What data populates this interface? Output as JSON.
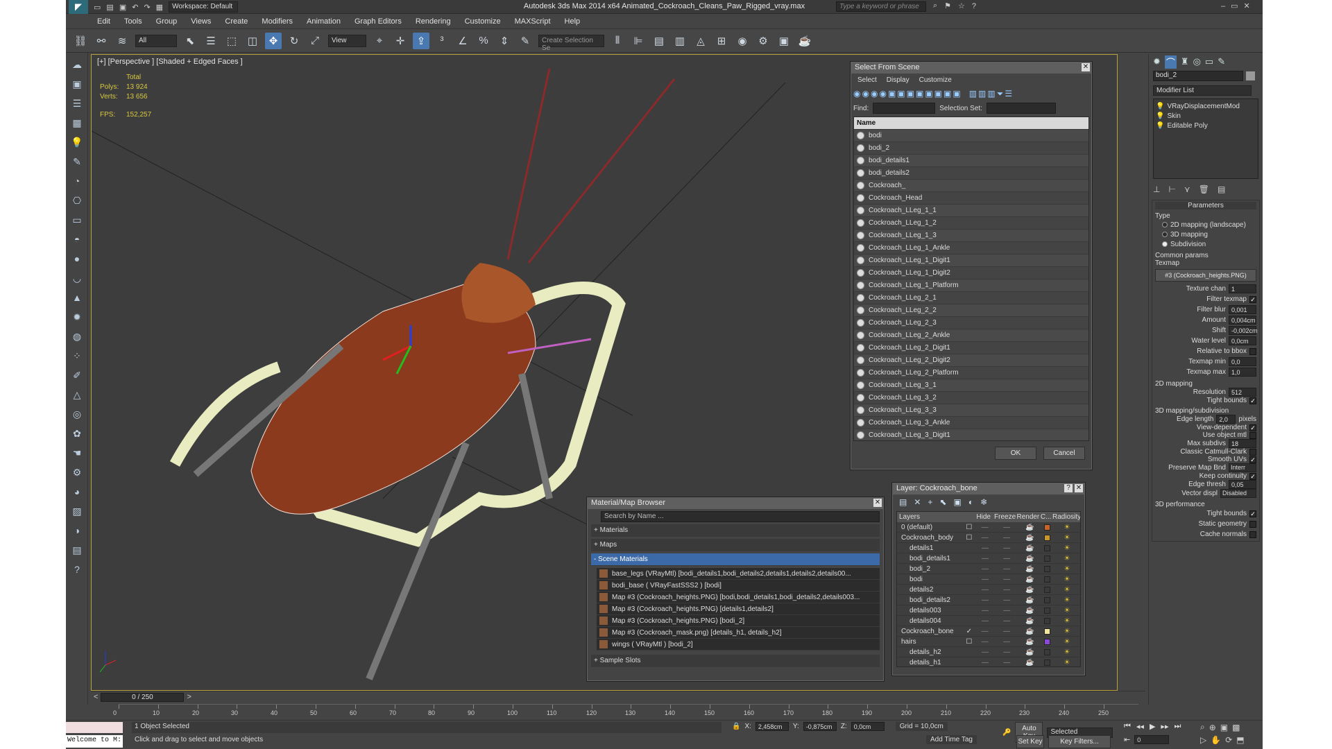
{
  "app": {
    "title": "Autodesk 3ds Max  2014 x64     Animated_Cockroach_Cleans_Paw_Rigged_vray.max",
    "workspace": "Workspace: Default",
    "search_placeholder": "Type a keyword or phrase"
  },
  "menu": [
    "Edit",
    "Tools",
    "Group",
    "Views",
    "Create",
    "Modifiers",
    "Animation",
    "Graph Editors",
    "Rendering",
    "Customize",
    "MAXScript",
    "Help"
  ],
  "toolbar": {
    "filter": "All",
    "refcoord": "View",
    "selection_set_placeholder": "Create Selection Se"
  },
  "viewport": {
    "label": "[+] [Perspective ] [Shaded + Edged Faces ]",
    "stats": {
      "total_label": "Total",
      "polys_label": "Polys:",
      "polys": "13 924",
      "verts_label": "Verts:",
      "verts": "13 656",
      "fps_label": "FPS:",
      "fps": "152,257"
    }
  },
  "select_from_scene": {
    "title": "Select From Scene",
    "tabs": [
      "Select",
      "Display",
      "Customize"
    ],
    "find_label": "Find:",
    "selection_set_label": "Selection Set:",
    "column": "Name",
    "items": [
      "bodi",
      "bodi_2",
      "bodi_details1",
      "bodi_details2",
      "Cockroach_",
      "Cockroach_Head",
      "Cockroach_LLeg_1_1",
      "Cockroach_LLeg_1_2",
      "Cockroach_LLeg_1_3",
      "Cockroach_LLeg_1_Ankle",
      "Cockroach_LLeg_1_Digit1",
      "Cockroach_LLeg_1_Digit2",
      "Cockroach_LLeg_1_Platform",
      "Cockroach_LLeg_2_1",
      "Cockroach_LLeg_2_2",
      "Cockroach_LLeg_2_3",
      "Cockroach_LLeg_2_Ankle",
      "Cockroach_LLeg_2_Digit1",
      "Cockroach_LLeg_2_Digit2",
      "Cockroach_LLeg_2_Platform",
      "Cockroach_LLeg_3_1",
      "Cockroach_LLeg_3_2",
      "Cockroach_LLeg_3_3",
      "Cockroach_LLeg_3_Ankle",
      "Cockroach_LLeg_3_Digit1"
    ],
    "ok": "OK",
    "cancel": "Cancel"
  },
  "material_browser": {
    "title": "Material/Map Browser",
    "search_placeholder": "Search by Name ...",
    "groups": [
      "+ Materials",
      "+ Maps",
      "- Scene Materials"
    ],
    "items": [
      "base_legs (VRayMtl) [bodi_details1,bodi_details2,details1,details2,details00...",
      "bodi_base ( VRayFastSSS2 ) [bodi]",
      "Map #3 (Cockroach_heights.PNG) [bodi,bodi_details1,bodi_details2,details003...",
      "Map #3 (Cockroach_heights.PNG) [details1,details2]",
      "Map #3 (Cockroach_heights.PNG) [bodi_2]",
      "Map #3 (Cockroach_mask.png) [details_h1, details_h2]",
      "wings ( VRayMtl ) [bodi_2]"
    ],
    "sample_slots": "+ Sample Slots"
  },
  "layer_dialog": {
    "title": "Layer: Cockroach_bone",
    "help": "?",
    "columns": [
      "Layers",
      "Hide",
      "Freeze",
      "Render",
      "C...",
      "Radiosity"
    ],
    "rows": [
      {
        "name": "0 (default)",
        "indent": 0,
        "color": "#c8642a",
        "check": "☐"
      },
      {
        "name": "Cockroach_body",
        "indent": 0,
        "color": "#c8962a",
        "check": "☐"
      },
      {
        "name": "details1",
        "indent": 1,
        "color": "",
        "check": ""
      },
      {
        "name": "bodi_details1",
        "indent": 1,
        "color": "",
        "check": ""
      },
      {
        "name": "bodi_2",
        "indent": 1,
        "color": "",
        "check": ""
      },
      {
        "name": "bodi",
        "indent": 1,
        "color": "",
        "check": ""
      },
      {
        "name": "details2",
        "indent": 1,
        "color": "",
        "check": ""
      },
      {
        "name": "bodi_details2",
        "indent": 1,
        "color": "",
        "check": ""
      },
      {
        "name": "details003",
        "indent": 1,
        "color": "",
        "check": ""
      },
      {
        "name": "details004",
        "indent": 1,
        "color": "",
        "check": ""
      },
      {
        "name": "Cockroach_bone",
        "indent": 0,
        "color": "#f0e6a0",
        "check": "✓"
      },
      {
        "name": "hairs",
        "indent": 0,
        "color": "#8a4ad8",
        "check": "☐"
      },
      {
        "name": "details_h2",
        "indent": 1,
        "color": "",
        "check": ""
      },
      {
        "name": "details_h1",
        "indent": 1,
        "color": "",
        "check": ""
      }
    ]
  },
  "command_panel": {
    "object_name": "bodi_2",
    "modifier_list": "Modifier List",
    "stack": [
      "VRayDisplacementMod",
      "Skin",
      "Editable Poly"
    ],
    "parameters": "Parameters",
    "type_label": "Type",
    "type_options": [
      "2D mapping (landscape)",
      "3D mapping",
      "Subdivision"
    ],
    "type_selected": 2,
    "common_params": "Common params",
    "texmap_label": "Texmap",
    "texmap_value": "#3 (Cockroach_heights.PNG)",
    "fields": [
      {
        "label": "Texture chan",
        "value": "1"
      },
      {
        "label": "Filter texmap",
        "value": "✓"
      },
      {
        "label": "Filter blur",
        "value": "0,001"
      },
      {
        "label": "Amount",
        "value": "0,004cm"
      },
      {
        "label": "Shift",
        "value": "-0,002cm"
      },
      {
        "label": "Water level",
        "value": "0,0cm"
      },
      {
        "label": "Relative to bbox",
        "value": ""
      },
      {
        "label": "Texmap min",
        "value": "0,0"
      },
      {
        "label": "Texmap max",
        "value": "1,0"
      }
    ],
    "mapping2d": "2D mapping",
    "resolution_label": "Resolution",
    "resolution": "512",
    "tight_bounds": "Tight bounds",
    "mapping3d": "3D mapping/subdivision",
    "edge_length_label": "Edge length",
    "edge_length": "2,0",
    "pixels": "pixels",
    "view_dependent": "View-dependent",
    "use_object_mtl": "Use object mtl",
    "max_subdivs_label": "Max subdivs",
    "max_subdivs": "18",
    "catmull": "Classic Catmull-Clark",
    "smooth_uvs": "Smooth UVs",
    "preserve_label": "Preserve Map Bnd",
    "preserve_value": "Interr",
    "keep_continuity": "Keep continuity",
    "edge_thresh_label": "Edge thresh",
    "edge_thresh": "0,05",
    "vector_label": "Vector displ",
    "vector_value": "Disabled",
    "perf": "3D performance",
    "perf_items": [
      "Tight bounds",
      "Static geometry",
      "Cache normals"
    ]
  },
  "timeline": {
    "frame": "0 / 250",
    "ticks": [
      "0",
      "10",
      "20",
      "30",
      "40",
      "50",
      "60",
      "70",
      "80",
      "90",
      "100",
      "110",
      "120",
      "130",
      "140",
      "150",
      "160",
      "170",
      "180",
      "190",
      "200",
      "210",
      "220",
      "230",
      "240",
      "250"
    ]
  },
  "status": {
    "welcome": "Welcome to M:",
    "selected": "1 Object Selected",
    "prompt": "Click and drag to select and move objects",
    "x_label": "X:",
    "x": "2,458cm",
    "y_label": "Y:",
    "y": "-0,875cm",
    "z_label": "Z:",
    "z": "0,0cm",
    "grid": "Grid = 10,0cm",
    "add_time_tag": "Add Time Tag",
    "auto_key": "Auto Key",
    "set_key": "Set Key",
    "selected_dropdown": "Selected",
    "key_filters": "Key Filters...",
    "frame_field": "0"
  }
}
